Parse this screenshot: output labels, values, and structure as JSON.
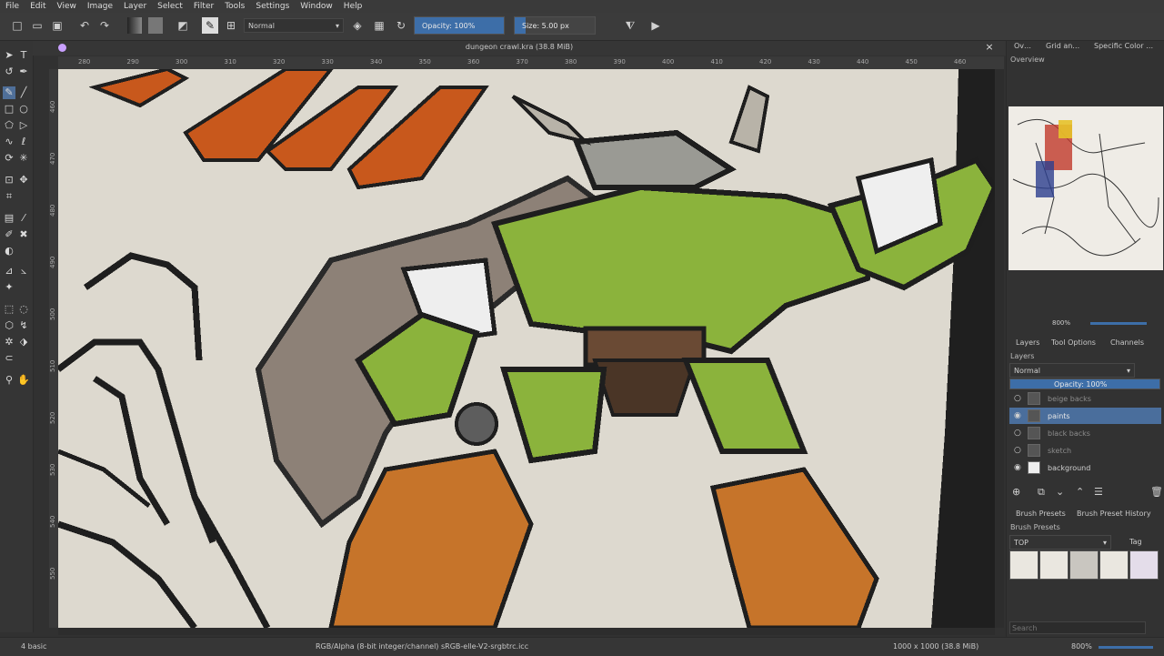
{
  "menu": [
    "File",
    "Edit",
    "View",
    "Image",
    "Layer",
    "Select",
    "Filter",
    "Tools",
    "Settings",
    "Window",
    "Help"
  ],
  "toolbar": {
    "blend_mode": "Normal",
    "opacity_label": "Opacity: 100%",
    "opacity_value": 1.0,
    "size_label": "Size: 5.00 px"
  },
  "document": {
    "title": "dungeon crawl.kra (38.8 MiB)",
    "close_glyph": "×"
  },
  "ruler": {
    "top_ticks": [
      "280",
      "290",
      "300",
      "310",
      "320",
      "330",
      "340",
      "350",
      "360",
      "370",
      "380",
      "390",
      "400",
      "410",
      "420",
      "430",
      "440",
      "450",
      "460"
    ],
    "left_ticks": [
      "460",
      "470",
      "480",
      "490",
      "500",
      "510",
      "520",
      "530",
      "540",
      "550"
    ]
  },
  "docker": {
    "top_tabs": [
      "Ov…",
      "Grid an…",
      "Specific Color …"
    ],
    "overview_label": "Overview",
    "zoom_label": "800%",
    "panel_tabs": [
      "Layers",
      "Tool Options",
      "Channels"
    ],
    "layers_label": "Layers",
    "blend_mode": "Normal",
    "opacity_label": "Opacity: 100%",
    "layers": [
      {
        "name": "beige backs",
        "visible": false,
        "active": false
      },
      {
        "name": "paints",
        "visible": true,
        "active": true
      },
      {
        "name": "black backs",
        "visible": false,
        "active": false
      },
      {
        "name": "sketch",
        "visible": false,
        "active": false
      },
      {
        "name": "background",
        "visible": true,
        "active": false
      }
    ],
    "preset_tabs": [
      "Brush Presets",
      "Brush Preset History"
    ],
    "presets_label": "Brush Presets",
    "tag_filter": "TOP",
    "tag_label": "Tag",
    "search_placeholder": "Search"
  },
  "status": {
    "brush": "4 basic",
    "color_profile": "RGB/Alpha (8-bit integer/channel)  sRGB-elle-V2-srgbtrc.icc",
    "image_size": "1000 x 1000 (38.8 MiB)",
    "zoom": "800%"
  },
  "colors": {
    "accent": "#3d6ea8",
    "canvas_bg": "#ddd9cf",
    "orc_green": "#8bb33c",
    "fur_orange": "#c6742a",
    "cape_gray": "#8d8177"
  }
}
